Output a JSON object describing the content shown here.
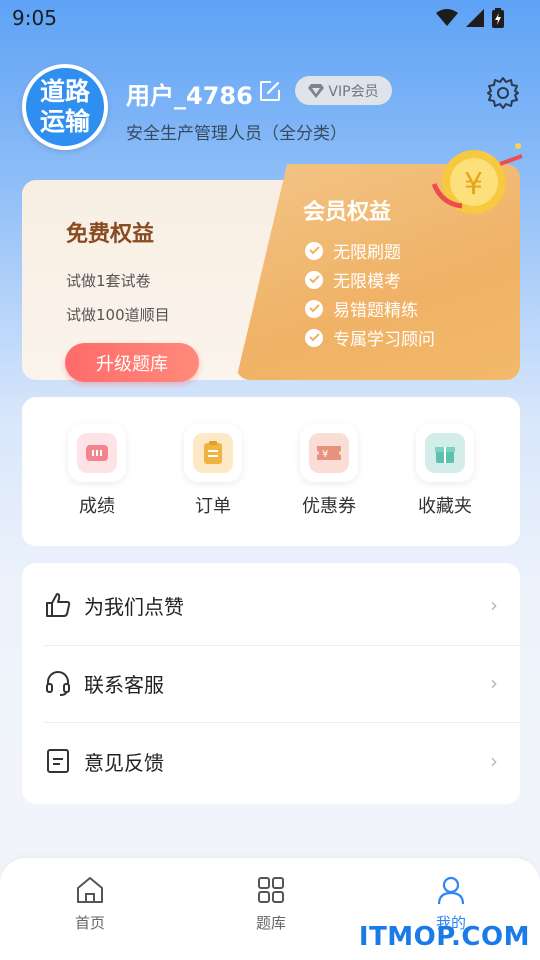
{
  "status_bar": {
    "time": "9:05"
  },
  "profile": {
    "logo_line1": "道路",
    "logo_line2": "运输",
    "username": "用户_4786",
    "vip_label": "VIP会员",
    "role": "安全生产管理人员（全分类）"
  },
  "benefits": {
    "free_title": "免费权益",
    "free_items": [
      "试做1套试卷",
      "试做100道顺目"
    ],
    "upgrade_label": "升级题库",
    "member_title": "会员权益",
    "member_items": [
      "无限刷题",
      "无限模考",
      "易错题精练",
      "专属学习顾问"
    ]
  },
  "quick_actions": [
    {
      "label": "成绩",
      "icon": "score-icon"
    },
    {
      "label": "订单",
      "icon": "order-icon"
    },
    {
      "label": "优惠券",
      "icon": "coupon-icon"
    },
    {
      "label": "收藏夹",
      "icon": "favorites-icon"
    }
  ],
  "menu": [
    {
      "label": "为我们点赞",
      "icon": "thumbs-up-icon"
    },
    {
      "label": "联系客服",
      "icon": "headset-icon"
    },
    {
      "label": "意见反馈",
      "icon": "feedback-icon"
    }
  ],
  "tabs": [
    {
      "label": "首页",
      "icon": "home-icon",
      "active": false
    },
    {
      "label": "题库",
      "icon": "grid-icon",
      "active": false
    },
    {
      "label": "我的",
      "icon": "user-icon",
      "active": true
    }
  ],
  "watermark": "ITMOP.COM",
  "colors": {
    "accent": "#2e86f5",
    "upgrade": "#ff6b6b",
    "member": "#f0b266"
  }
}
